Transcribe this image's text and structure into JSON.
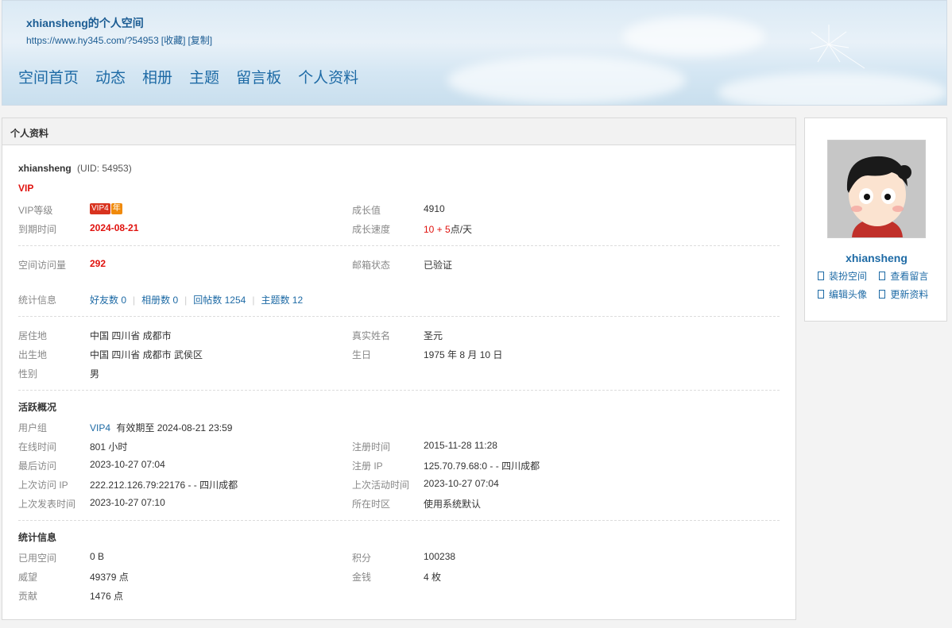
{
  "header": {
    "title": "xhiansheng的个人空间",
    "url": "https://www.hy345.com/?54953",
    "bookmark": "[收藏]",
    "copy": "[复制]",
    "nav": [
      "空间首页",
      "动态",
      "相册",
      "主题",
      "留言板",
      "个人资料"
    ]
  },
  "panel": {
    "title": "个人资料",
    "username": "xhiansheng",
    "uid": "(UID: 54953)",
    "vip": "VIP",
    "vip_level_label": "VIP等级",
    "vip_badge": "VIP4",
    "vip_badge_year": "年",
    "growth_label": "成长值",
    "growth_value": "4910",
    "expire_label": "到期时间",
    "expire_value": "2024-08-21",
    "growth_speed_label": "成长速度",
    "growth_speed_a": "10 + 5",
    "growth_speed_b": "点/天",
    "visits_label": "空间访问量",
    "visits_value": "292",
    "email_label": "邮箱状态",
    "email_value": "已验证",
    "stats_label": "统计信息",
    "stats": [
      "好友数 0",
      "相册数 0",
      "回帖数 1254",
      "主题数 12"
    ],
    "residence_label": "居住地",
    "residence_value": "中国 四川省 成都市",
    "realname_label": "真实姓名",
    "realname_value": "圣元",
    "birthplace_label": "出生地",
    "birthplace_value": "中国 四川省 成都市 武侯区",
    "birthday_label": "生日",
    "birthday_value": "1975 年 8 月 10 日",
    "gender_label": "性别",
    "gender_value": "男"
  },
  "activity": {
    "heading": "活跃概况",
    "group_label": "用户组",
    "group_value": "VIP4",
    "group_expire": "有效期至 2024-08-21 23:59",
    "online_label": "在线时间",
    "online_value": "801 小时",
    "reg_time_label": "注册时间",
    "reg_time_value": "2015-11-28 11:28",
    "last_visit_label": "最后访问",
    "last_visit_value": "2023-10-27 07:04",
    "reg_ip_label": "注册 IP",
    "reg_ip_value": "125.70.79.68:0 - - 四川成都",
    "last_ip_label": "上次访问 IP",
    "last_ip_value": "222.212.126.79:22176 - - 四川成都",
    "last_active_label": "上次活动时间",
    "last_active_value": "2023-10-27 07:04",
    "last_post_label": "上次发表时间",
    "last_post_value": "2023-10-27 07:10",
    "timezone_label": "所在时区",
    "timezone_value": "使用系统默认"
  },
  "statistics": {
    "heading": "统计信息",
    "space_label": "已用空间",
    "space_value": "0 B",
    "points_label": "积分",
    "points_value": "100238",
    "prestige_label": "威望",
    "prestige_value": "49379 点",
    "money_label": "金钱",
    "money_value": "4 枚",
    "contrib_label": "贡献",
    "contrib_value": "1476 点"
  },
  "sidebar": {
    "name": "xhiansheng",
    "links": [
      "装扮空间",
      "查看留言",
      "编辑头像",
      "更新资料"
    ]
  },
  "colors": {
    "link": "#1d6aa5",
    "accent_red": "#e0120e",
    "header_bg": "#dbeaf5"
  }
}
